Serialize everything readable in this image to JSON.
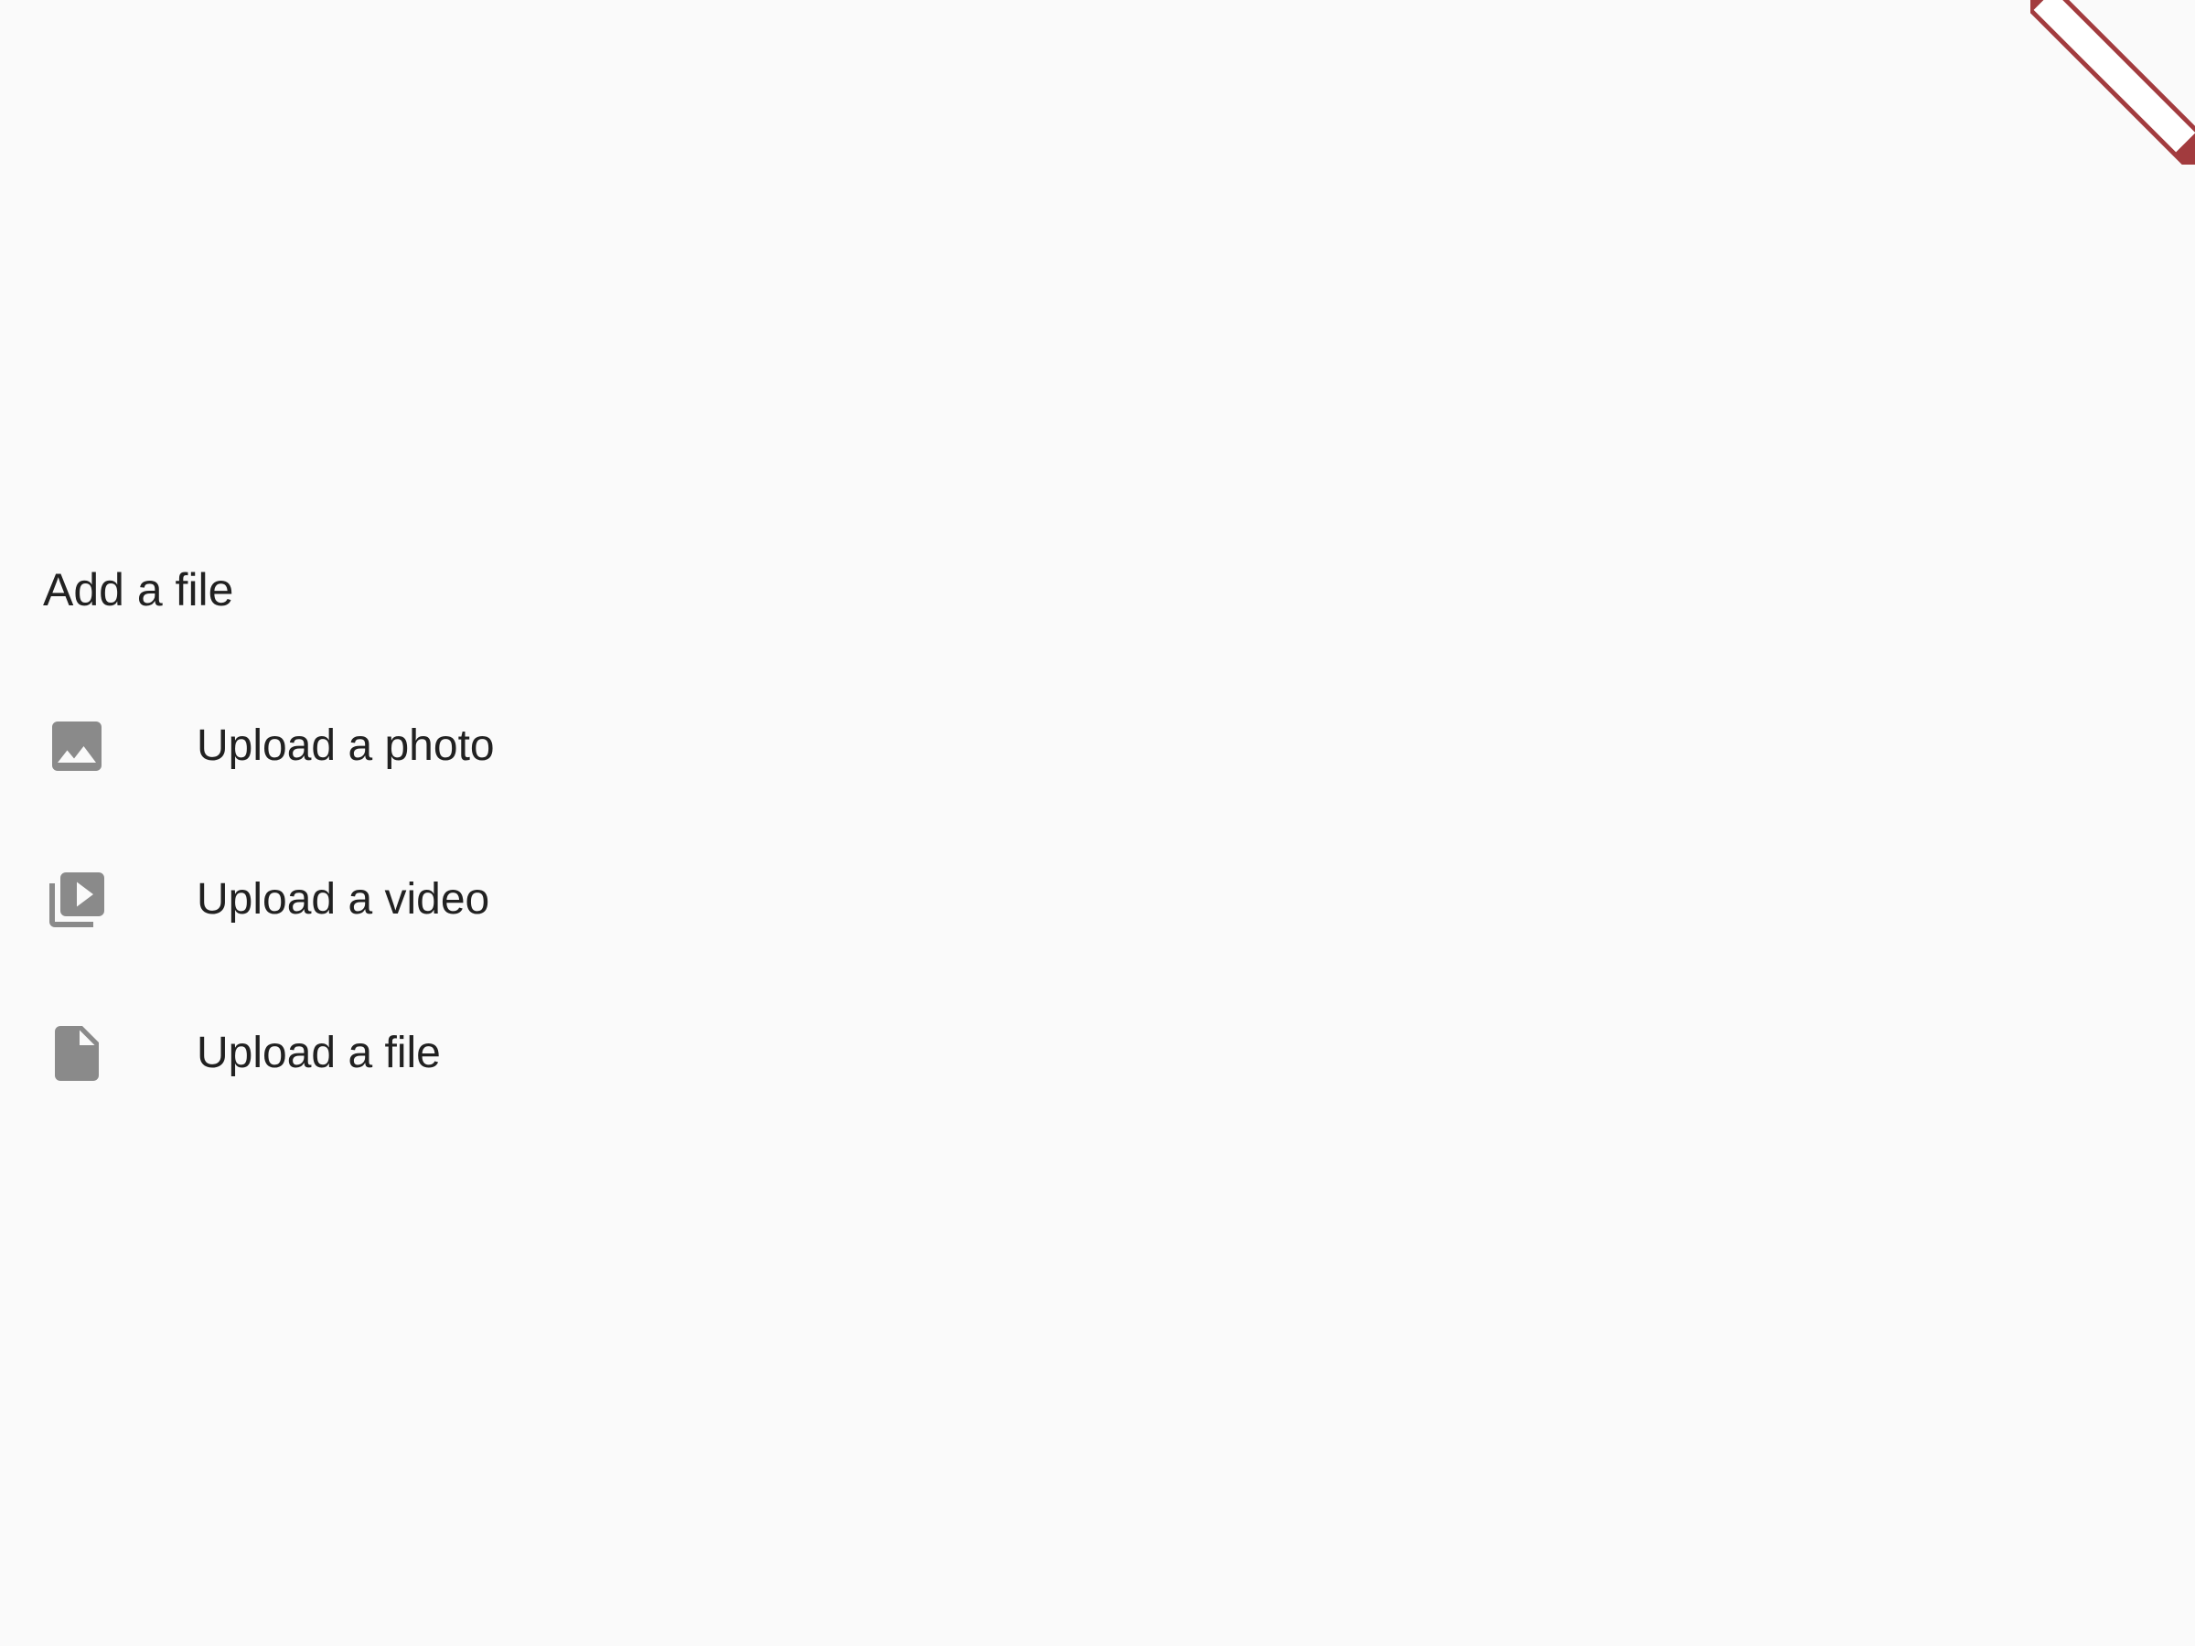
{
  "sheet": {
    "title": "Add a file",
    "items": [
      {
        "label": "Upload a photo",
        "icon": "image-icon"
      },
      {
        "label": "Upload a video",
        "icon": "video-library-icon"
      },
      {
        "label": "Upload a file",
        "icon": "file-icon"
      }
    ]
  },
  "colors": {
    "background": "#fafafa",
    "text": "#212121",
    "icon": "#8a8a8a",
    "debug_banner": "#a23b3e"
  }
}
